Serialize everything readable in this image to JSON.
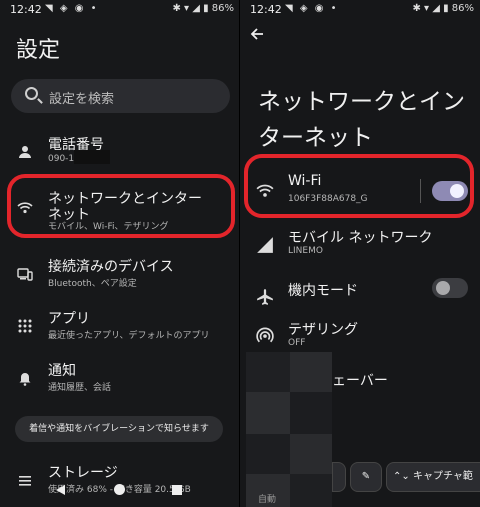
{
  "left": {
    "status": {
      "time": "12:42",
      "icons": "◥ ◈ ◉ •",
      "right": "✱ ▾ ◢ ▮ 86%"
    },
    "title": "設定",
    "search": {
      "placeholder": "設定を検索"
    },
    "items": [
      {
        "icon": "person-icon",
        "title": "電話番号",
        "subtitle": "090-1"
      },
      {
        "icon": "wifi-icon",
        "title": "ネットワークとインターネット",
        "subtitle": "モバイル、Wi-Fi、テザリング"
      },
      {
        "icon": "devices-icon",
        "title": "接続済みのデバイス",
        "subtitle": "Bluetooth、ペア設定"
      },
      {
        "icon": "apps-icon",
        "title": "アプリ",
        "subtitle": "最近使ったアプリ、デフォルトのアプリ"
      },
      {
        "icon": "bell-icon",
        "title": "通知",
        "subtitle": "通知履歴、会話"
      },
      {
        "icon": "storage-icon",
        "title": "ストレージ",
        "subtitle": "使用済み 68% - 空き容量 20.5 GB"
      }
    ],
    "toast": "着信や通知をバイブレーションで知らせます"
  },
  "right": {
    "status": {
      "time": "12:42",
      "icons": "◥ ◈ ◉ •",
      "right": "✱ ▾ ◢ ▮ 86%"
    },
    "title": "ネットワークとインターネット",
    "items": [
      {
        "icon": "wifi-icon",
        "title": "Wi-Fi",
        "subtitle": "106F3F88A678_G",
        "toggle": true
      },
      {
        "icon": "signal-icon",
        "title": "モバイル ネットワーク",
        "subtitle": "LINEMO"
      },
      {
        "icon": "airplane-icon",
        "title": "機内モード",
        "toggle": false
      },
      {
        "icon": "hotspot-icon",
        "title": "テザリング",
        "subtitle": "OFF"
      },
      {
        "icon": "dns-icon",
        "title": "ェーバー"
      }
    ],
    "pills": {
      "edit_icon": "✎",
      "capture": "キャプチャ範"
    },
    "bottom_text": "自動"
  }
}
